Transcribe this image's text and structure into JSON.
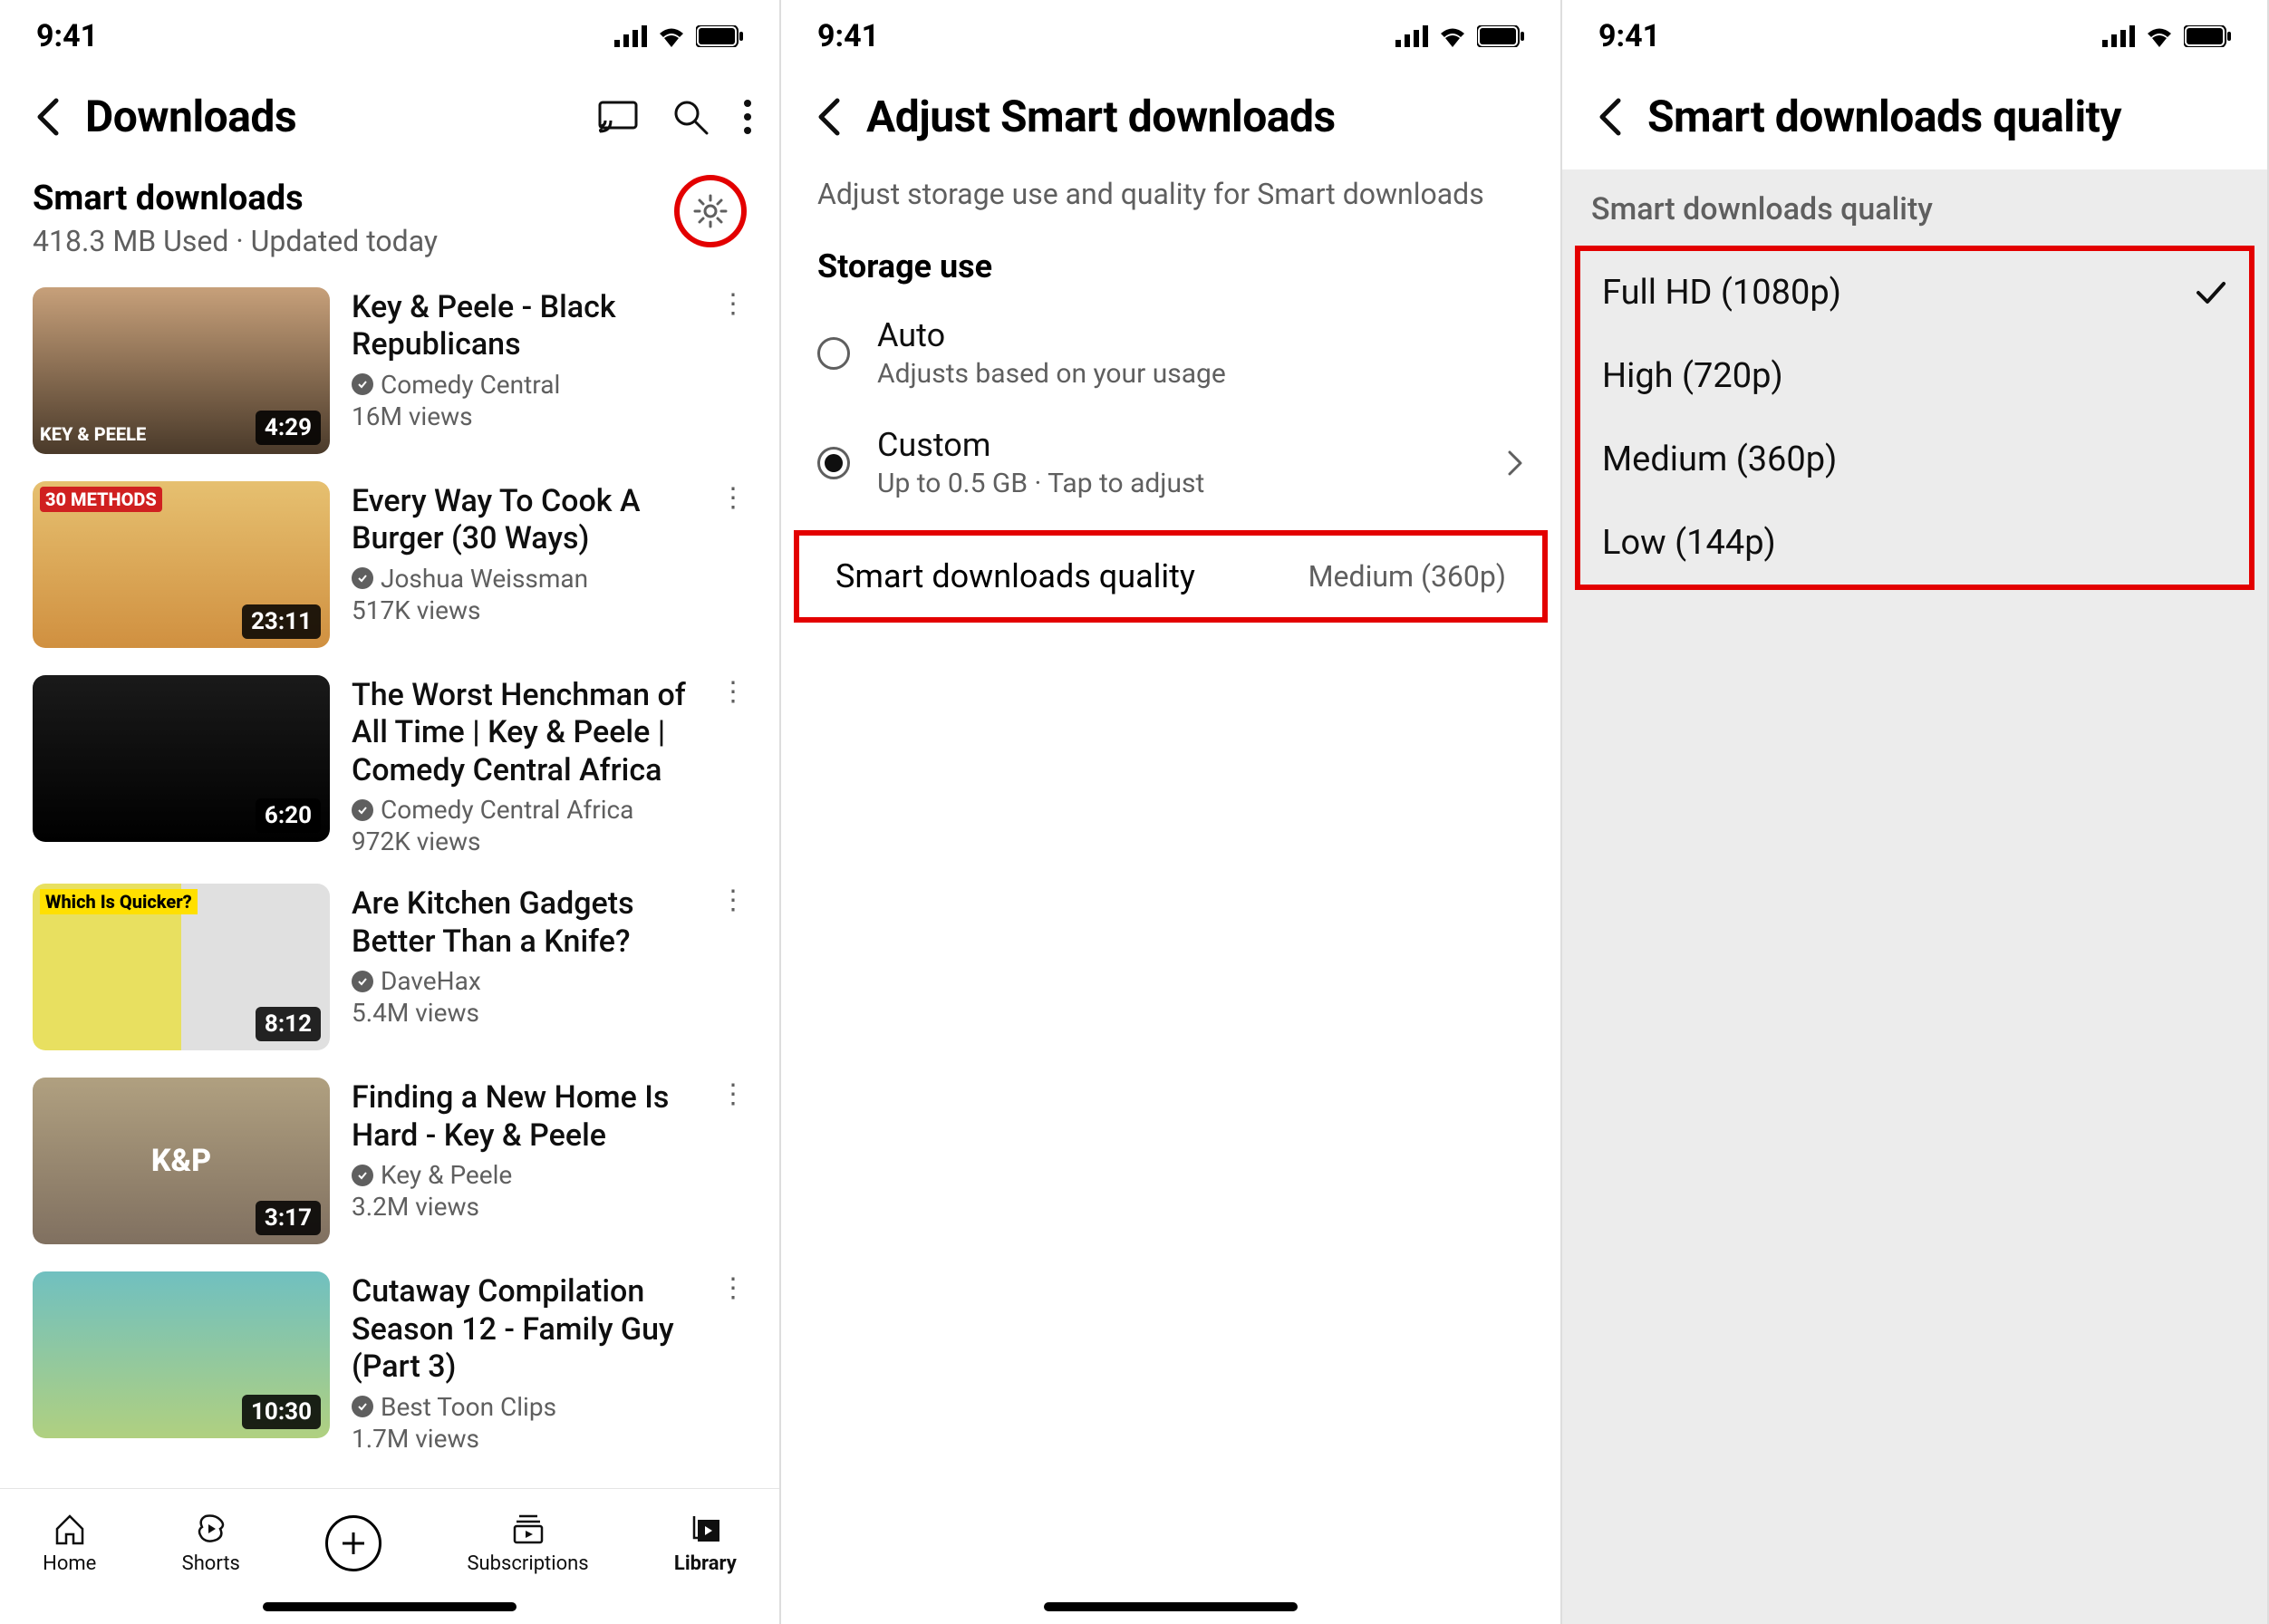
{
  "status": {
    "time": "9:41"
  },
  "panel1": {
    "title": "Downloads",
    "smart": {
      "title": "Smart downloads",
      "subtitle": "418.3 MB Used · Updated today"
    },
    "videos": [
      {
        "title": "Key & Peele - Black Republicans",
        "channel": "Comedy Central",
        "views": "16M views",
        "duration": "4:29",
        "overlay": "KEY & PEELE"
      },
      {
        "title": "Every Way To Cook A Burger (30 Ways)",
        "channel": "Joshua Weissman",
        "views": "517K views",
        "duration": "23:11",
        "overlay": "30 METHODS"
      },
      {
        "title": "The Worst Henchman of All Time | Key & Peele | Comedy Central Africa",
        "channel": "Comedy Central Africa",
        "views": "972K views",
        "duration": "6:20",
        "overlay": ""
      },
      {
        "title": "Are Kitchen Gadgets Better Than a Knife?",
        "channel": "DaveHax",
        "views": "5.4M views",
        "duration": "8:12",
        "overlay": "Which Is Quicker?"
      },
      {
        "title": "Finding a New Home Is Hard - Key & Peele",
        "channel": "Key & Peele",
        "views": "3.2M views",
        "duration": "3:17",
        "overlay": "K&P"
      },
      {
        "title": "Cutaway Compilation Season 12 - Family Guy (Part 3)",
        "channel": "Best Toon Clips",
        "views": "1.7M views",
        "duration": "10:30",
        "overlay": ""
      }
    ],
    "nav": {
      "home": "Home",
      "shorts": "Shorts",
      "subscriptions": "Subscriptions",
      "library": "Library"
    }
  },
  "panel2": {
    "title": "Adjust Smart downloads",
    "subtitle": "Adjust storage use and quality for Smart downloads",
    "section": "Storage use",
    "auto": {
      "title": "Auto",
      "sub": "Adjusts based on your usage"
    },
    "custom": {
      "title": "Custom",
      "sub": "Up to 0.5 GB · Tap to adjust"
    },
    "quality": {
      "label": "Smart downloads quality",
      "value": "Medium (360p)"
    }
  },
  "panel3": {
    "title": "Smart downloads quality",
    "section": "Smart downloads quality",
    "options": [
      {
        "label": "Full HD (1080p)",
        "selected": true
      },
      {
        "label": "High (720p)",
        "selected": false
      },
      {
        "label": "Medium (360p)",
        "selected": false
      },
      {
        "label": "Low (144p)",
        "selected": false
      }
    ]
  }
}
